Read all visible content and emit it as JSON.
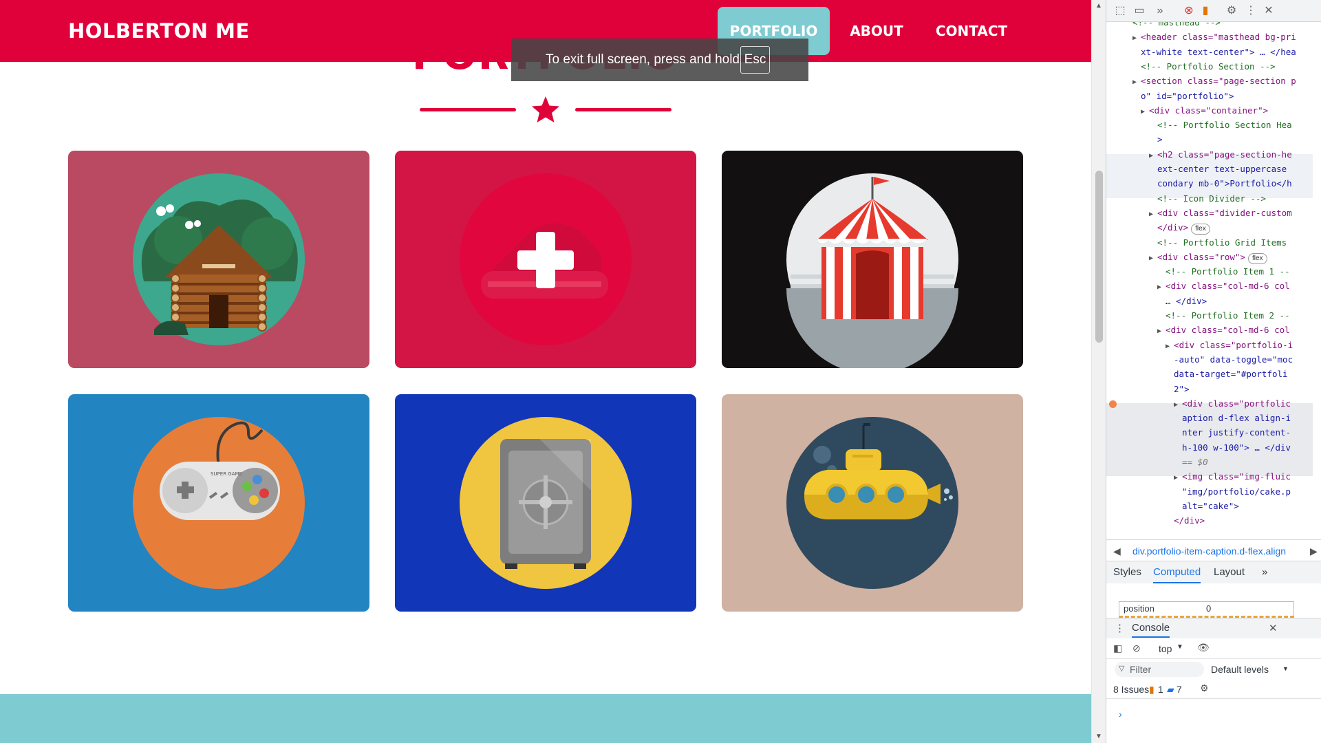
{
  "navbar": {
    "brand": "HOLBERTON ME",
    "links": [
      {
        "label": "PORTFOLIO",
        "active": true
      },
      {
        "label": "ABOUT",
        "active": false
      },
      {
        "label": "CONTACT",
        "active": false
      }
    ],
    "color": "#e0003a",
    "active_color": "#7ecbd1"
  },
  "section": {
    "heading": "PORTFOLIO"
  },
  "fullscreen_toast": {
    "message": "To exit full screen, press and hold",
    "key": "Esc"
  },
  "portfolio_items": [
    {
      "icon": "cabin-icon",
      "bg": "#b94a62"
    },
    {
      "icon": "cake-icon",
      "bg": "#d21545"
    },
    {
      "icon": "circus-tent-icon",
      "bg": "#121010"
    },
    {
      "icon": "game-controller-icon",
      "bg": "#2284c1",
      "label": "SUPER GAME"
    },
    {
      "icon": "safe-icon",
      "bg": "#1236b8"
    },
    {
      "icon": "submarine-icon",
      "bg": "#cfb2a2"
    }
  ],
  "devtools": {
    "elements_lines": [
      {
        "indent": 0,
        "html": "<!-- masthead -->"
      },
      {
        "indent": 1,
        "kind": "open",
        "text": "<header class=\"masthead bg-pri"
      },
      {
        "indent": 1,
        "kind": "cont",
        "text": "xt-white text-center\"> … </hea"
      },
      {
        "indent": 1,
        "kind": "comment",
        "text": "<!-- Portfolio Section -->"
      },
      {
        "indent": 1,
        "kind": "open",
        "text": "<section class=\"page-section p"
      },
      {
        "indent": 1,
        "kind": "cont",
        "text": "o\" id=\"portfolio\">"
      },
      {
        "indent": 2,
        "kind": "open",
        "text": "<div class=\"container\">"
      },
      {
        "indent": 3,
        "kind": "comment",
        "text": "<!-- Portfolio Section Hea"
      },
      {
        "indent": 3,
        "kind": "cont",
        "text": ">"
      },
      {
        "indent": 3,
        "kind": "open",
        "text": "<h2 class=\"page-section-he"
      },
      {
        "indent": 3,
        "kind": "cont",
        "text": "ext-center text-uppercase"
      },
      {
        "indent": 3,
        "kind": "cont",
        "text": "condary mb-0\">Portfolio</h"
      },
      {
        "indent": 3,
        "kind": "comment",
        "text": "<!-- Icon Divider -->"
      },
      {
        "indent": 3,
        "kind": "open",
        "text": "<div class=\"divider-custom"
      },
      {
        "indent": 3,
        "kind": "cont",
        "text": "</div>"
      },
      {
        "indent": 3,
        "kind": "comment",
        "text": "<!-- Portfolio Grid Items"
      },
      {
        "indent": 3,
        "kind": "open",
        "text": "<div class=\"row\">"
      },
      {
        "indent": 4,
        "kind": "comment",
        "text": "<!-- Portfolio Item 1 --"
      },
      {
        "indent": 4,
        "kind": "open",
        "text": "<div class=\"col-md-6 col"
      },
      {
        "indent": 4,
        "kind": "cont",
        "text": "… </div>"
      },
      {
        "indent": 4,
        "kind": "comment",
        "text": "<!-- Portfolio Item 2 --"
      },
      {
        "indent": 4,
        "kind": "open",
        "text": "<div class=\"col-md-6 col"
      },
      {
        "indent": 5,
        "kind": "open",
        "text": "<div class=\"portfolio-i"
      },
      {
        "indent": 5,
        "kind": "cont",
        "text": "-auto\" data-toggle=\"moc"
      },
      {
        "indent": 5,
        "kind": "cont",
        "text": "data-target=\"#portfoli"
      },
      {
        "indent": 5,
        "kind": "cont",
        "text": "2\">"
      },
      {
        "indent": 6,
        "kind": "open",
        "text": "<div class=\"portfolic"
      },
      {
        "indent": 6,
        "kind": "cont",
        "text": "aption d-flex align-i"
      },
      {
        "indent": 6,
        "kind": "cont",
        "text": "nter justify-content-"
      },
      {
        "indent": 6,
        "kind": "cont",
        "text": "h-100 w-100\"> … </div"
      },
      {
        "indent": 6,
        "kind": "cont",
        "text": "== $0"
      },
      {
        "indent": 6,
        "kind": "open",
        "text": "<img class=\"img-fluic"
      },
      {
        "indent": 6,
        "kind": "cont",
        "text": "\"img/portfolio/cake.p"
      },
      {
        "indent": 6,
        "kind": "cont",
        "text": "alt=\"cake\">"
      },
      {
        "indent": 5,
        "kind": "cont",
        "text": "</div>"
      }
    ],
    "flex_badge": "flex",
    "breadcrumb": "div.portfolio-item-caption.d-flex.align",
    "tabs": [
      "Styles",
      "Computed",
      "Layout"
    ],
    "active_tab": "Computed",
    "computed_filter": {
      "property": "position",
      "value": "0"
    },
    "console": {
      "title": "Console",
      "context": "top",
      "filter_placeholder": "Filter",
      "levels": "Default levels",
      "issues_label": "8 Issues:",
      "issues_warn": "1",
      "issues_info": "7",
      "prompt": "›"
    }
  }
}
